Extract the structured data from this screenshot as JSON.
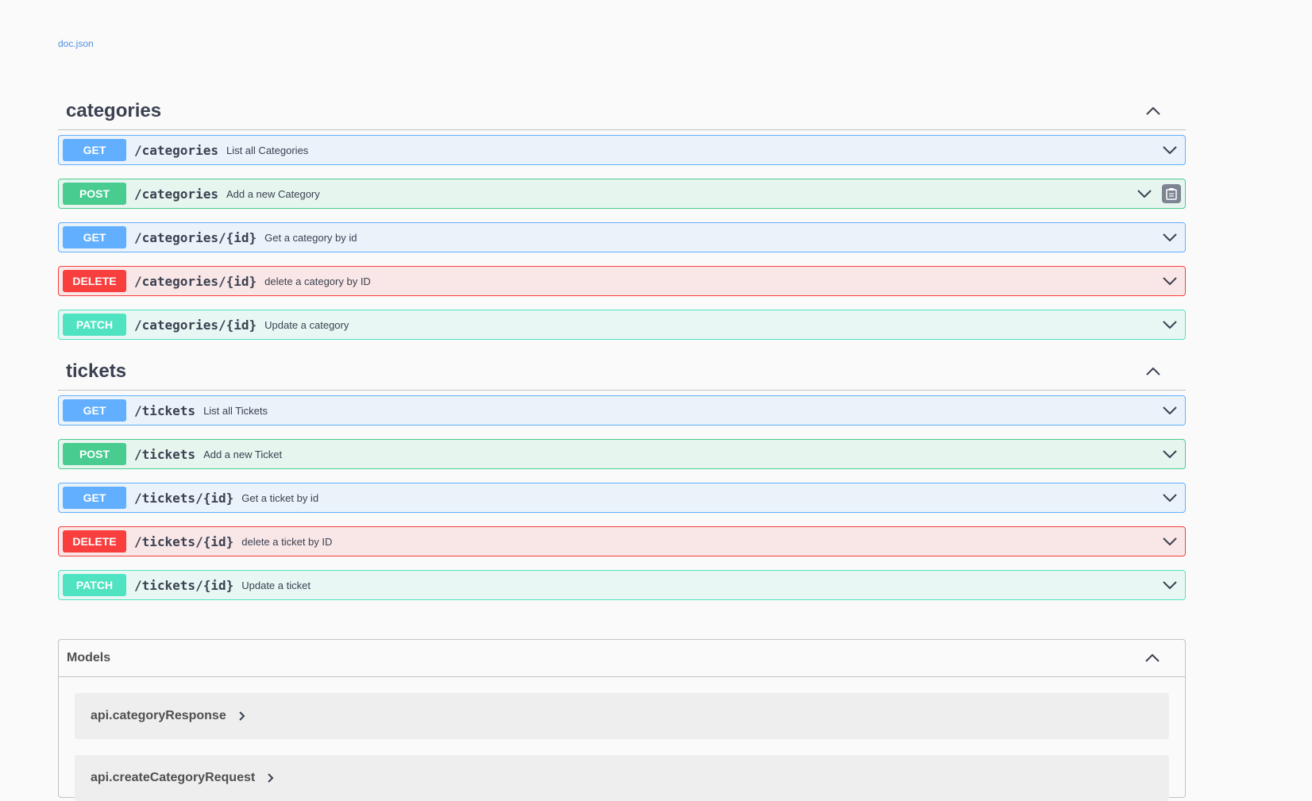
{
  "doc_link": "doc.json",
  "colors": {
    "get": "#61affe",
    "post": "#49cc90",
    "delete": "#f93e3e",
    "patch": "#50e3c2"
  },
  "tags": [
    {
      "name": "categories",
      "operations": [
        {
          "method": "GET",
          "path": "/categories",
          "summary": "List all Categories"
        },
        {
          "method": "POST",
          "path": "/categories",
          "summary": "Add a new Category"
        },
        {
          "method": "GET",
          "path": "/categories/{id}",
          "summary": "Get a category by id"
        },
        {
          "method": "DELETE",
          "path": "/categories/{id}",
          "summary": "delete a category by ID"
        },
        {
          "method": "PATCH",
          "path": "/categories/{id}",
          "summary": "Update a category"
        }
      ]
    },
    {
      "name": "tickets",
      "operations": [
        {
          "method": "GET",
          "path": "/tickets",
          "summary": "List all Tickets"
        },
        {
          "method": "POST",
          "path": "/tickets",
          "summary": "Add a new Ticket"
        },
        {
          "method": "GET",
          "path": "/tickets/{id}",
          "summary": "Get a ticket by id"
        },
        {
          "method": "DELETE",
          "path": "/tickets/{id}",
          "summary": "delete a ticket by ID"
        },
        {
          "method": "PATCH",
          "path": "/tickets/{id}",
          "summary": "Update a ticket"
        }
      ]
    }
  ],
  "models": {
    "title": "Models",
    "items": [
      "api.categoryResponse",
      "api.createCategoryRequest"
    ]
  }
}
